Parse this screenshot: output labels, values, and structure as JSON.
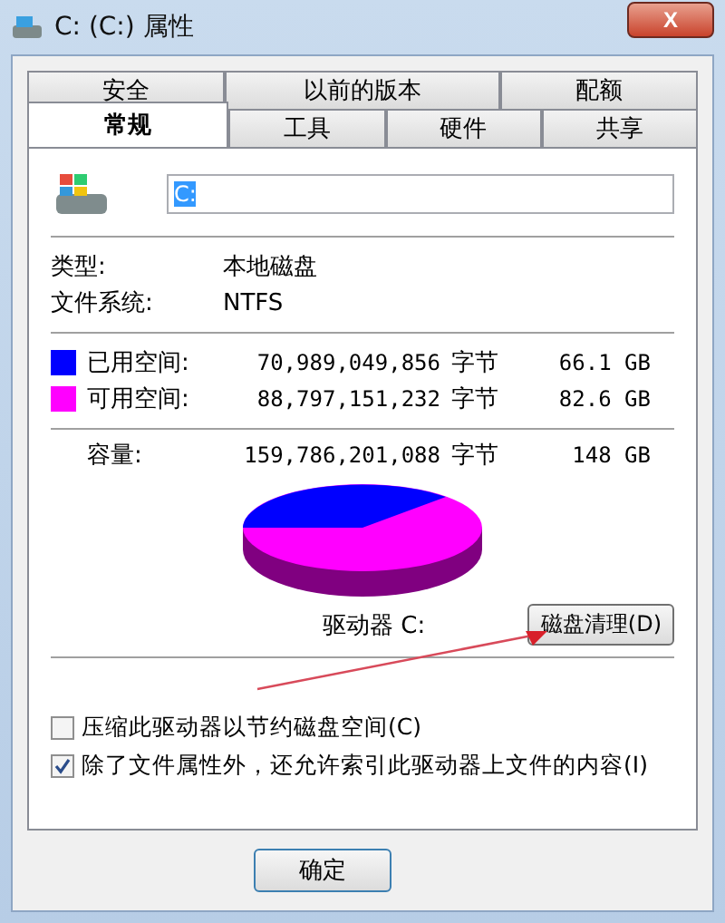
{
  "window": {
    "title": "C: (C:) 属性",
    "close": "X"
  },
  "tab_rows": [
    [
      {
        "label": "安全",
        "selected": false
      },
      {
        "label": "以前的版本",
        "selected": false
      },
      {
        "label": "配额",
        "selected": false
      }
    ],
    [
      {
        "label": "常规",
        "selected": true
      },
      {
        "label": "工具",
        "selected": false
      },
      {
        "label": "硬件",
        "selected": false
      },
      {
        "label": "共享",
        "selected": false
      }
    ]
  ],
  "name_field": {
    "value": "C:"
  },
  "info": [
    {
      "label": "类型:",
      "value": "本地磁盘"
    },
    {
      "label": "文件系统:",
      "value": "NTFS"
    }
  ],
  "space": [
    {
      "label": "已用空间:",
      "bytes": "70,989,049,856",
      "unit": "字节",
      "size": "66.1 GB",
      "color": "#0000ff"
    },
    {
      "label": "可用空间:",
      "bytes": "88,797,151,232",
      "unit": "字节",
      "size": "82.6 GB",
      "color": "#ff00ff"
    }
  ],
  "capacity": {
    "label": "容量:",
    "bytes": "159,786,201,088",
    "unit": "字节",
    "size": "148 GB"
  },
  "drive_label": "驱动器 C:",
  "cleanup_button": "磁盘清理(D)",
  "options": [
    {
      "label": "压缩此驱动器以节约磁盘空间(C)",
      "checked": false
    },
    {
      "label": "除了文件属性外，还允许索引此驱动器上文件的内容(I)",
      "checked": true
    }
  ],
  "buttons": [
    "确定"
  ]
}
